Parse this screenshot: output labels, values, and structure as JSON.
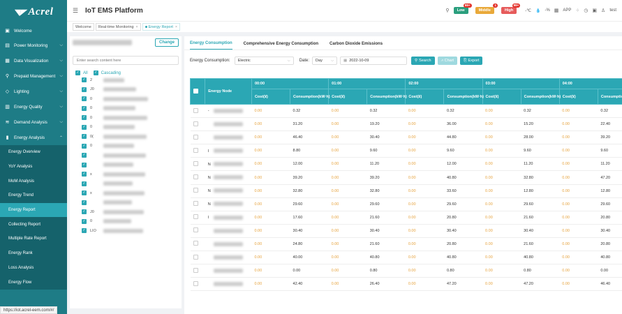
{
  "brand": {
    "logo_text": "Acrel",
    "app_title": "IoT EMS Platform"
  },
  "sidebar": {
    "items": [
      {
        "icon": "▣",
        "label": "Welcome"
      },
      {
        "icon": "▤",
        "label": "Power Monitoring"
      },
      {
        "icon": "▦",
        "label": "Data Visualization"
      },
      {
        "icon": "⚲",
        "label": "Prepaid Management"
      },
      {
        "icon": "◇",
        "label": "Lighting"
      },
      {
        "icon": "▥",
        "label": "Energy Quality"
      },
      {
        "icon": "≋",
        "label": "Demand Analysis"
      },
      {
        "icon": "▮",
        "label": "Energy Analysis"
      }
    ],
    "sub_items": [
      {
        "label": "Energy Overview"
      },
      {
        "label": "YoY Analysis"
      },
      {
        "label": "MoM Analysis"
      },
      {
        "label": "Energy Trend"
      },
      {
        "label": "Energy Report"
      },
      {
        "label": "Collecting Report"
      },
      {
        "label": "Multiple Rate Report"
      },
      {
        "label": "Energy Rank"
      },
      {
        "label": "Loss Analysis"
      },
      {
        "label": "Energy Flow"
      }
    ]
  },
  "header": {
    "low_label": "Low",
    "low_count": "99+",
    "middle_label": "Middle",
    "middle_count": "1",
    "high_label": "High",
    "high_count": "99+",
    "temp": "-℃",
    "humidity": "-%",
    "app_label": "APP",
    "user": "test"
  },
  "page_tabs": [
    {
      "label": "Welcome"
    },
    {
      "label": "Real-time Monitoring"
    },
    {
      "label": "Energy Report"
    }
  ],
  "tree": {
    "change_label": "Change",
    "search_placeholder": "Enter search content here",
    "all_label": "All",
    "cascading_label": "Cascading",
    "nodes": [
      {
        "label": "2"
      },
      {
        "label": "J0"
      },
      {
        "label": "0"
      },
      {
        "label": "0"
      },
      {
        "label": "0"
      },
      {
        "label": "0"
      },
      {
        "label": "0("
      },
      {
        "label": "0"
      },
      {
        "label": ""
      },
      {
        "label": ""
      },
      {
        "label": "x"
      },
      {
        "label": ""
      },
      {
        "label": "x"
      },
      {
        "label": ""
      },
      {
        "label": "J0"
      },
      {
        "label": "0"
      },
      {
        "label": "LIO"
      }
    ]
  },
  "main": {
    "tabs": [
      {
        "label": "Energy Consumption"
      },
      {
        "label": "Comprehensive Energy Consumption"
      },
      {
        "label": "Carbon Dioxide Emissions"
      }
    ],
    "energy_label": "Energy Consumption:",
    "energy_value": "Electric",
    "date_label": "Date:",
    "date_type": "Day",
    "date_value": "2022-10-09",
    "search_label": "Search",
    "chart_label": "Chart",
    "export_label": "Export"
  },
  "table": {
    "node_header": "Energy Node",
    "hours": [
      "00:00",
      "01:00",
      "02:00",
      "03:00",
      "04:00"
    ],
    "cost_header": "Cost(¥)",
    "cons_header": "Consumption(kW·h)",
    "rows": [
      {
        "node": "-",
        "values": [
          [
            "0.00",
            "0.32"
          ],
          [
            "0.00",
            "0.32"
          ],
          [
            "0.00",
            "0.32"
          ],
          [
            "0.00",
            "0.32"
          ],
          [
            "0.00",
            "0.32"
          ]
        ]
      },
      {
        "node": "",
        "values": [
          [
            "0.00",
            "31.20"
          ],
          [
            "0.00",
            "19.20"
          ],
          [
            "0.00",
            "36.00"
          ],
          [
            "0.00",
            "15.20"
          ],
          [
            "0.00",
            "22.40"
          ]
        ]
      },
      {
        "node": "",
        "values": [
          [
            "0.00",
            "46.40"
          ],
          [
            "0.00",
            "30.40"
          ],
          [
            "0.00",
            "44.80"
          ],
          [
            "0.00",
            "28.00"
          ],
          [
            "0.00",
            "39.20"
          ]
        ]
      },
      {
        "node": "I",
        "values": [
          [
            "0.00",
            "8.80"
          ],
          [
            "0.00",
            "9.60"
          ],
          [
            "0.00",
            "9.60"
          ],
          [
            "0.00",
            "9.60"
          ],
          [
            "0.00",
            "9.60"
          ]
        ]
      },
      {
        "node": "N",
        "values": [
          [
            "0.00",
            "12.00"
          ],
          [
            "0.00",
            "11.20"
          ],
          [
            "0.00",
            "12.00"
          ],
          [
            "0.00",
            "11.20"
          ],
          [
            "0.00",
            "11.20"
          ]
        ]
      },
      {
        "node": "N",
        "values": [
          [
            "0.00",
            "39.20"
          ],
          [
            "0.00",
            "39.20"
          ],
          [
            "0.00",
            "40.80"
          ],
          [
            "0.00",
            "32.80"
          ],
          [
            "0.00",
            "47.20"
          ]
        ]
      },
      {
        "node": "N",
        "values": [
          [
            "0.00",
            "32.80"
          ],
          [
            "0.00",
            "32.80"
          ],
          [
            "0.00",
            "33.60"
          ],
          [
            "0.00",
            "12.80"
          ],
          [
            "0.00",
            "12.80"
          ]
        ]
      },
      {
        "node": "N",
        "values": [
          [
            "0.00",
            "29.60"
          ],
          [
            "0.00",
            "29.60"
          ],
          [
            "0.00",
            "29.60"
          ],
          [
            "0.00",
            "29.60"
          ],
          [
            "0.00",
            "29.60"
          ]
        ]
      },
      {
        "node": "I",
        "values": [
          [
            "0.00",
            "17.60"
          ],
          [
            "0.00",
            "21.60"
          ],
          [
            "0.00",
            "20.80"
          ],
          [
            "0.00",
            "21.60"
          ],
          [
            "0.00",
            "20.80"
          ]
        ]
      },
      {
        "node": "",
        "values": [
          [
            "0.00",
            "30.40"
          ],
          [
            "0.00",
            "30.40"
          ],
          [
            "0.00",
            "30.40"
          ],
          [
            "0.00",
            "30.40"
          ],
          [
            "0.00",
            "30.40"
          ]
        ]
      },
      {
        "node": "",
        "values": [
          [
            "0.00",
            "24.80"
          ],
          [
            "0.00",
            "21.60"
          ],
          [
            "0.00",
            "20.80"
          ],
          [
            "0.00",
            "21.60"
          ],
          [
            "0.00",
            "20.80"
          ]
        ]
      },
      {
        "node": "",
        "values": [
          [
            "0.00",
            "40.00"
          ],
          [
            "0.00",
            "40.80"
          ],
          [
            "0.00",
            "40.80"
          ],
          [
            "0.00",
            "40.80"
          ],
          [
            "0.00",
            "40.80"
          ]
        ]
      },
      {
        "node": "",
        "values": [
          [
            "0.00",
            "0.00"
          ],
          [
            "0.00",
            "0.80"
          ],
          [
            "0.00",
            "0.80"
          ],
          [
            "0.00",
            "0.80"
          ],
          [
            "0.00",
            "0.00"
          ]
        ]
      },
      {
        "node": "",
        "values": [
          [
            "0.00",
            "42.40"
          ],
          [
            "0.00",
            "26.40"
          ],
          [
            "0.00",
            "47.20"
          ],
          [
            "0.00",
            "47.20"
          ],
          [
            "0.00",
            "46.40"
          ]
        ]
      }
    ]
  },
  "status_url": "https://iot.acrel-eem.com/#/"
}
